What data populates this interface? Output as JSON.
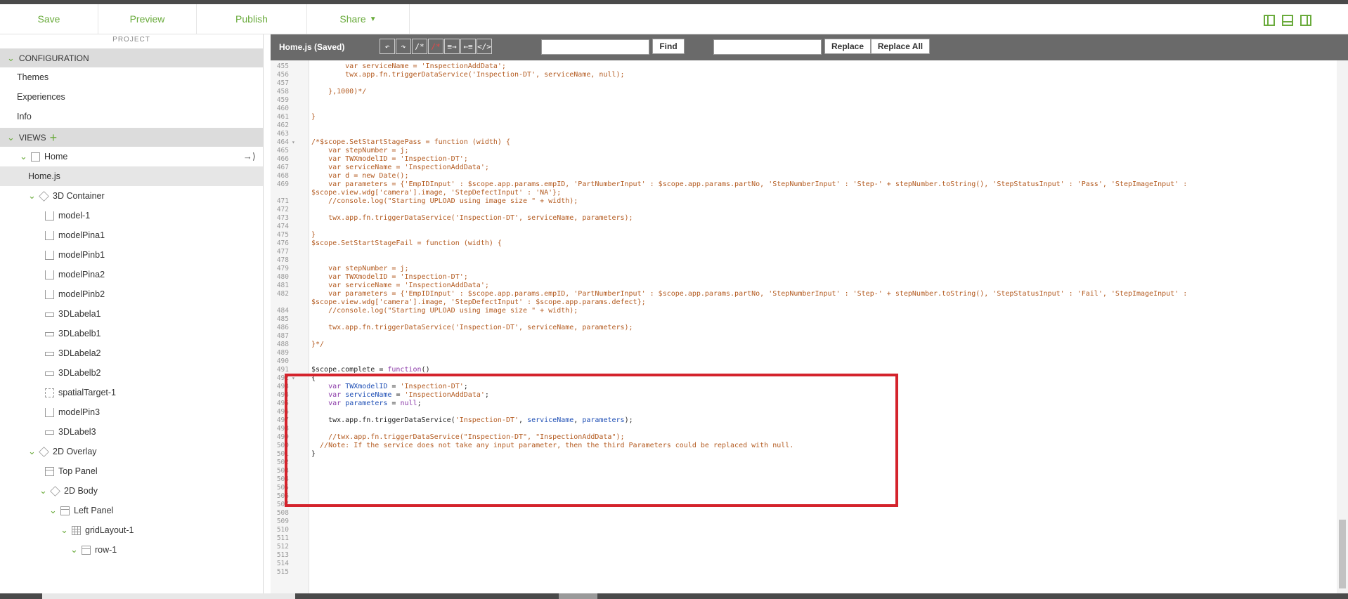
{
  "toolbar": {
    "save": "Save",
    "preview": "Preview",
    "publish": "Publish",
    "share": "Share"
  },
  "sidebar": {
    "header": "PROJECT",
    "configuration": "CONFIGURATION",
    "config_items": [
      "Themes",
      "Experiences",
      "Info"
    ],
    "views": "VIEWS",
    "tree": [
      {
        "label": "Home",
        "level": 1,
        "chev": true,
        "icon": "box"
      },
      {
        "label": "Home.js",
        "level": 1,
        "chev": false,
        "icon": "",
        "selected": true
      },
      {
        "label": "3D Container",
        "level": 2,
        "chev": true,
        "icon": "cube"
      },
      {
        "label": "model-1",
        "level": 3,
        "chev": false,
        "icon": "model"
      },
      {
        "label": "modelPina1",
        "level": 3,
        "chev": false,
        "icon": "model"
      },
      {
        "label": "modelPinb1",
        "level": 3,
        "chev": false,
        "icon": "model"
      },
      {
        "label": "modelPina2",
        "level": 3,
        "chev": false,
        "icon": "model"
      },
      {
        "label": "modelPinb2",
        "level": 3,
        "chev": false,
        "icon": "model"
      },
      {
        "label": "3DLabela1",
        "level": 3,
        "chev": false,
        "icon": "label"
      },
      {
        "label": "3DLabelb1",
        "level": 3,
        "chev": false,
        "icon": "label"
      },
      {
        "label": "3DLabela2",
        "level": 3,
        "chev": false,
        "icon": "label"
      },
      {
        "label": "3DLabelb2",
        "level": 3,
        "chev": false,
        "icon": "label"
      },
      {
        "label": "spatialTarget-1",
        "level": 3,
        "chev": false,
        "icon": "target"
      },
      {
        "label": "modelPin3",
        "level": 3,
        "chev": false,
        "icon": "model"
      },
      {
        "label": "3DLabel3",
        "level": 3,
        "chev": false,
        "icon": "label"
      },
      {
        "label": "2D Overlay",
        "level": 2,
        "chev": true,
        "icon": "cube"
      },
      {
        "label": "Top Panel",
        "level": 3,
        "chev": false,
        "icon": "panel"
      },
      {
        "label": "2D Body",
        "level": 3,
        "chev": true,
        "icon": "cube"
      },
      {
        "label": "Left Panel",
        "level": 4,
        "chev": true,
        "icon": "panel"
      },
      {
        "label": "gridLayout-1",
        "level": 5,
        "chev": true,
        "icon": "grid"
      },
      {
        "label": "row-1",
        "level": 6,
        "chev": true,
        "icon": "panel"
      }
    ]
  },
  "editor": {
    "title": "Home.js (Saved)",
    "tools": [
      "undo",
      "redo",
      "comment",
      "uncomment",
      "indent",
      "outdent",
      "format"
    ],
    "find_label": "Find",
    "find_value": "",
    "replace_value": "",
    "replace_label": "Replace",
    "replace_all_label": "Replace All",
    "lines": [
      {
        "n": "455",
        "t": "        var serviceName = 'InspectionAddData';",
        "f": ""
      },
      {
        "n": "456",
        "t": "        twx.app.fn.triggerDataService('Inspection-DT', serviceName, null);",
        "f": ""
      },
      {
        "n": "457",
        "t": "",
        "f": ""
      },
      {
        "n": "458",
        "t": "    },1000)*/",
        "f": ""
      },
      {
        "n": "459",
        "t": "",
        "f": ""
      },
      {
        "n": "460",
        "t": "",
        "f": ""
      },
      {
        "n": "461",
        "t": "}",
        "f": ""
      },
      {
        "n": "462",
        "t": "",
        "f": ""
      },
      {
        "n": "463",
        "t": "",
        "f": ""
      },
      {
        "n": "464",
        "t": "/*$scope.SetStartStagePass = function (width) {",
        "f": "▾"
      },
      {
        "n": "465",
        "t": "    var stepNumber = j;",
        "f": ""
      },
      {
        "n": "466",
        "t": "    var TWXmodelID = 'Inspection-DT';",
        "f": ""
      },
      {
        "n": "467",
        "t": "    var serviceName = 'InspectionAddData';",
        "f": ""
      },
      {
        "n": "468",
        "t": "    var d = new Date();",
        "f": ""
      },
      {
        "n": "469",
        "t": "    var parameters = {'EmpIDInput' : $scope.app.params.empID, 'PartNumberInput' : $scope.app.params.partNo, 'StepNumberInput' : 'Step-' + stepNumber.toString(), 'StepStatusInput' : 'Pass', 'StepImageInput' :",
        "f": ""
      },
      {
        "n": "",
        "t": "$scope.view.wdg['camera'].image, 'StepDefectInput' : 'NA'};",
        "f": ""
      },
      {
        "n": "471",
        "t": "    //console.log(\"Starting UPLOAD using image size \" + width);",
        "f": ""
      },
      {
        "n": "472",
        "t": "",
        "f": ""
      },
      {
        "n": "473",
        "t": "    twx.app.fn.triggerDataService('Inspection-DT', serviceName, parameters);",
        "f": ""
      },
      {
        "n": "474",
        "t": "",
        "f": ""
      },
      {
        "n": "475",
        "t": "}",
        "f": ""
      },
      {
        "n": "476",
        "t": "$scope.SetStartStageFail = function (width) {",
        "f": ""
      },
      {
        "n": "477",
        "t": "",
        "f": ""
      },
      {
        "n": "478",
        "t": "",
        "f": ""
      },
      {
        "n": "479",
        "t": "    var stepNumber = j;",
        "f": ""
      },
      {
        "n": "480",
        "t": "    var TWXmodelID = 'Inspection-DT';",
        "f": ""
      },
      {
        "n": "481",
        "t": "    var serviceName = 'InspectionAddData';",
        "f": ""
      },
      {
        "n": "482",
        "t": "    var parameters = {'EmpIDInput' : $scope.app.params.empID, 'PartNumberInput' : $scope.app.params.partNo, 'StepNumberInput' : 'Step-' + stepNumber.toString(), 'StepStatusInput' : 'Fail', 'StepImageInput' :",
        "f": ""
      },
      {
        "n": "",
        "t": "$scope.view.wdg['camera'].image, 'StepDefectInput' : $scope.app.params.defect};",
        "f": ""
      },
      {
        "n": "484",
        "t": "    //console.log(\"Starting UPLOAD using image size \" + width);",
        "f": ""
      },
      {
        "n": "485",
        "t": "",
        "f": ""
      },
      {
        "n": "486",
        "t": "    twx.app.fn.triggerDataService('Inspection-DT', serviceName, parameters);",
        "f": ""
      },
      {
        "n": "487",
        "t": "",
        "f": ""
      },
      {
        "n": "488",
        "t": "}*/",
        "f": ""
      },
      {
        "n": "489",
        "t": "",
        "f": ""
      },
      {
        "n": "490",
        "t": "",
        "f": ""
      },
      {
        "n": "491",
        "t": "$scope.complete = function()",
        "f": ""
      },
      {
        "n": "492",
        "t": "{",
        "f": "▾"
      },
      {
        "n": "493",
        "t": "    var TWXmodelID = 'Inspection-DT';",
        "f": ""
      },
      {
        "n": "494",
        "t": "    var serviceName = 'InspectionAddData';",
        "f": ""
      },
      {
        "n": "495",
        "t": "    var parameters = null;",
        "f": ""
      },
      {
        "n": "496",
        "t": "",
        "f": ""
      },
      {
        "n": "497",
        "t": "    twx.app.fn.triggerDataService('Inspection-DT', serviceName, parameters);",
        "f": ""
      },
      {
        "n": "498",
        "t": "",
        "f": ""
      },
      {
        "n": "499",
        "t": "    //twx.app.fn.triggerDataService(\"Inspection-DT\", \"InspectionAddData\");",
        "f": ""
      },
      {
        "n": "500",
        "t": "  //Note: If the service does not take any input parameter, then the third Parameters could be replaced with null.",
        "f": ""
      },
      {
        "n": "501",
        "t": "}",
        "f": ""
      },
      {
        "n": "502",
        "t": "",
        "f": ""
      },
      {
        "n": "503",
        "t": "",
        "f": ""
      },
      {
        "n": "504",
        "t": "",
        "f": ""
      },
      {
        "n": "505",
        "t": "",
        "f": ""
      },
      {
        "n": "506",
        "t": "",
        "f": ""
      },
      {
        "n": "507",
        "t": "",
        "f": ""
      },
      {
        "n": "508",
        "t": "",
        "f": ""
      },
      {
        "n": "509",
        "t": "",
        "f": ""
      },
      {
        "n": "510",
        "t": "",
        "f": ""
      },
      {
        "n": "511",
        "t": "",
        "f": ""
      },
      {
        "n": "512",
        "t": "",
        "f": ""
      },
      {
        "n": "513",
        "t": "",
        "f": ""
      },
      {
        "n": "514",
        "t": "",
        "f": ""
      },
      {
        "n": "515",
        "t": "",
        "f": ""
      }
    ]
  },
  "colors": {
    "accent": "#6aab3c",
    "highlight": "#d4232c",
    "editor_header": "#6a6a6a"
  }
}
